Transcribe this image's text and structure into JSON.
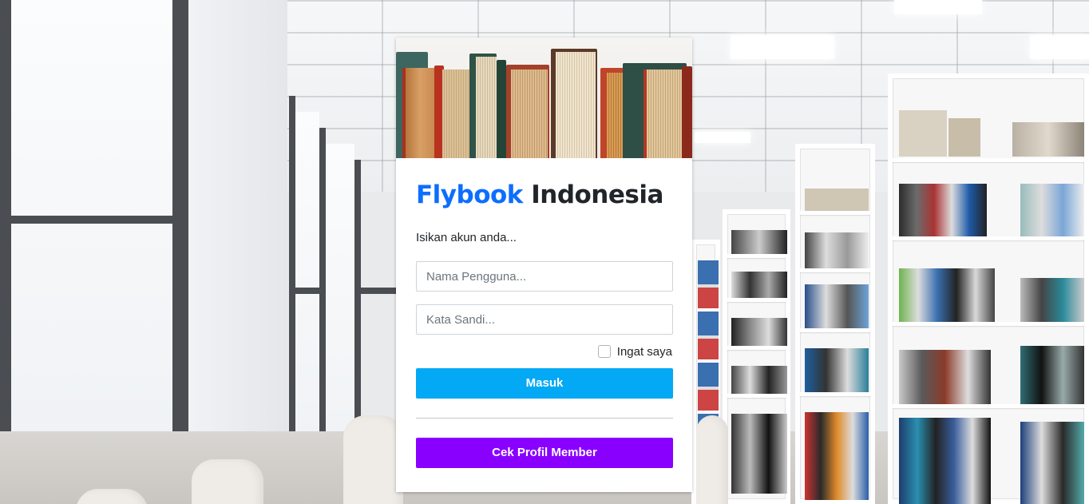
{
  "app": {
    "brand_highlight": "Flybook",
    "brand_rest": "Indonesia"
  },
  "login": {
    "subtitle": "Isikan akun anda...",
    "username_placeholder": "Nama Pengguna...",
    "password_placeholder": "Kata Sandi...",
    "remember_label": "Ingat saya",
    "login_button": "Masuk",
    "profile_button": "Cek Profil Member"
  },
  "colors": {
    "brand": "#0d6efd",
    "login_button": "#03a9f4",
    "profile_button": "#8a00ff"
  },
  "icons": {
    "hero_image": "books-photo",
    "background_image": "library-photo"
  }
}
